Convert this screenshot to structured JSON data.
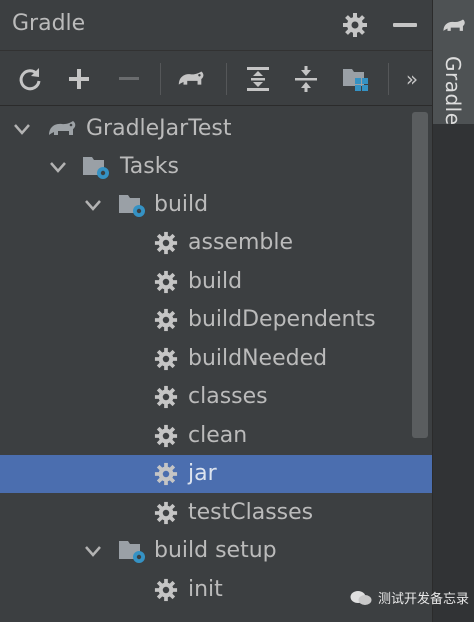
{
  "panel": {
    "title": "Gradle",
    "icons": [
      "gear-icon",
      "minimize-icon"
    ]
  },
  "toolbar": {
    "buttons": [
      {
        "name": "reload-icon",
        "enabled": true
      },
      {
        "name": "plus-icon",
        "enabled": true
      },
      {
        "name": "minus-icon",
        "enabled": false
      },
      {
        "name": "elephant-run-icon",
        "enabled": true
      },
      {
        "name": "expand-all-icon",
        "enabled": true
      },
      {
        "name": "collapse-all-icon",
        "enabled": true
      },
      {
        "name": "dependencies-icon",
        "enabled": true
      },
      {
        "name": "more-icon",
        "enabled": true
      }
    ],
    "more_label": "»"
  },
  "tree": {
    "project": {
      "label": "GradleJarTest",
      "expanded": true
    },
    "tasks_folder": {
      "label": "Tasks",
      "expanded": true
    },
    "build_group": {
      "label": "build",
      "expanded": true,
      "tasks": [
        "assemble",
        "build",
        "buildDependents",
        "buildNeeded",
        "classes",
        "clean",
        "jar",
        "testClasses"
      ],
      "selected": "jar"
    },
    "build_setup_group": {
      "label": "build setup",
      "expanded": true,
      "tasks": [
        "init"
      ]
    }
  },
  "side_panel": {
    "label": "Gradle",
    "icon": "elephant-icon"
  },
  "watermark": {
    "text": "测试开发备忘录"
  },
  "colors": {
    "background": "#3c3f41",
    "selection": "#4b6eaf",
    "text": "#bbbbbb",
    "folder_blue": "#3592c4"
  }
}
